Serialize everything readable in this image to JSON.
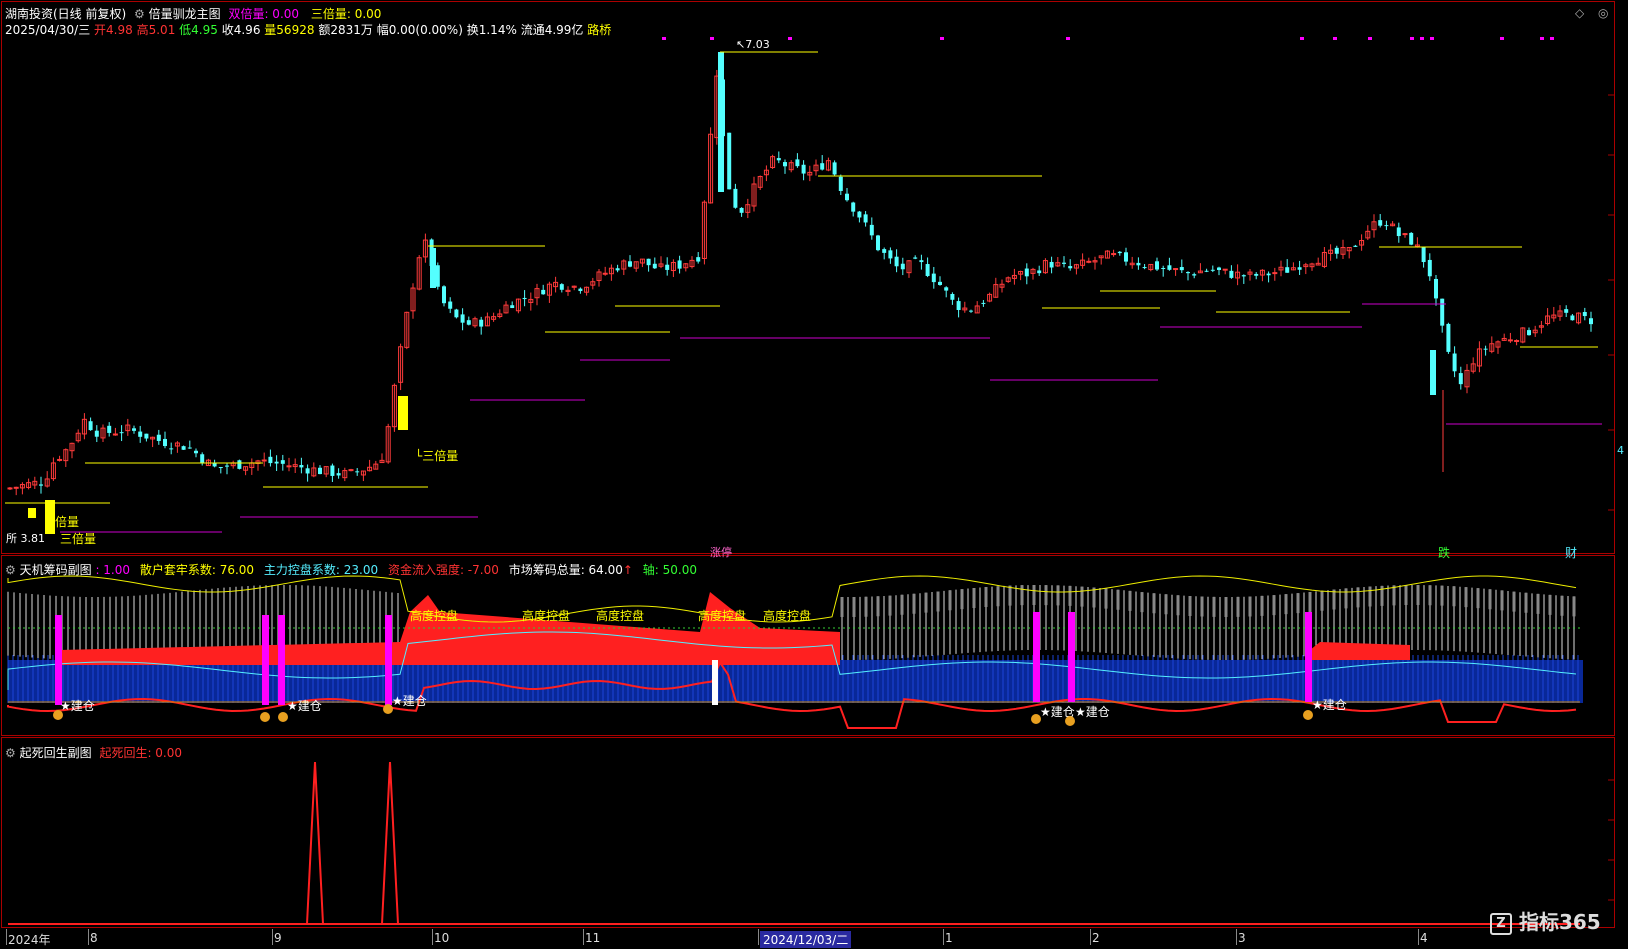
{
  "header": {
    "stock_name": "湖南投资(日线 前复权)",
    "indicator_name": "倍量驯龙主图",
    "double_vol_label": "双倍量: 0.00",
    "triple_vol_label": "三倍量: 0.00",
    "date": "2025/04/30/三",
    "open": "开4.98",
    "high": "高5.01",
    "low": "低4.95",
    "close": "收4.96",
    "volume": "量56928",
    "amount": "额2831万",
    "change": "幅0.00(0.00%)",
    "turnover": "换1.14%",
    "float_cap": "流通4.99亿",
    "road": "路桥",
    "diamond_icon": "diamond-icon"
  },
  "main_annotations": {
    "peak_value": "7.03",
    "low_value": "3.81",
    "triple_1": "三倍量",
    "triple_2": "三倍量",
    "double_1": "倍量",
    "tag_left": "所",
    "tag_mid": "涨停",
    "tag_die": "跌",
    "tag_cai": "财",
    "right_label": "4"
  },
  "sub1": {
    "title": "天机筹码副图",
    "v1": ": 1.00",
    "retail": "散户套牢系数: 76.00",
    "main": "主力控盘系数: 23.00",
    "fund": "资金流入强度: -7.00",
    "market": "市场筹码总量: 64.00",
    "arrow": "↑",
    "axis": "轴: 50.00",
    "control_label": "高度控盘",
    "build_label": "建仓"
  },
  "sub2": {
    "title": "起死回生副图",
    "value": "起死回生: 0.00"
  },
  "xaxis": {
    "labels": [
      "2024年",
      "8",
      "9",
      "10",
      "11",
      "2024/12/03/二",
      "1",
      "2",
      "3",
      "4"
    ]
  },
  "logo": "指标365",
  "colors": {
    "up": "#ff3b3b",
    "down": "#54ffff",
    "yellow": "#ffff00",
    "magenta": "#ff00ff",
    "red": "#ff2020",
    "blue": "#0a2ca8"
  },
  "chart_data": {
    "type": "candlestick",
    "ylim": [
      3.5,
      7.3
    ],
    "annotations": {
      "high": 7.03,
      "low": 3.81
    },
    "sub1_axis": 50,
    "sub2_spikes": [
      {
        "date": "2024-09-10",
        "value": 1
      },
      {
        "date": "2024-09-24",
        "value": 1
      }
    ]
  }
}
